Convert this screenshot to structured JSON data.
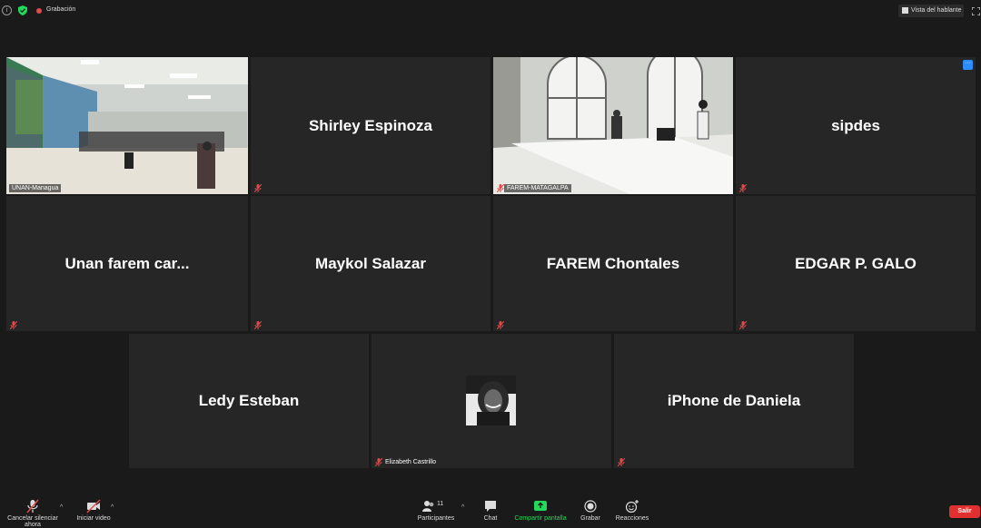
{
  "topbar": {
    "recording_label": "Grabación",
    "speaker_view_label": "Vista del hablante"
  },
  "tiles": {
    "unan_managua": "UNAN-Managua",
    "shirley": "Shirley Espinoza",
    "farem_matagalpa": "FAREM-MATAGALPA",
    "sipdes": "sipdes",
    "unan_farem": "Unan farem car...",
    "maykol": "Maykol Salazar",
    "farem_chontales": "FAREM Chontales",
    "edgar": "EDGAR P. GALO",
    "ledy": "Ledy Esteban",
    "elizabeth": "Elizabeth Castrillo",
    "iphone": "iPhone de Daniela",
    "more_label": "···"
  },
  "toolbar": {
    "mute_label": "Cancelar silenciar ahora",
    "video_label": "Iniciar video",
    "participants_label": "Participantes",
    "participants_count": "11",
    "chat_label": "Chat",
    "share_label": "Compartir pantalla",
    "record_label": "Grabar",
    "reactions_label": "Reacciones",
    "leave_label": "Salir"
  },
  "colors": {
    "active_speaker_border": "#d8e24c",
    "share_green": "#23d959",
    "leave_red": "#e0302f",
    "mute_red": "#e24b4b"
  }
}
